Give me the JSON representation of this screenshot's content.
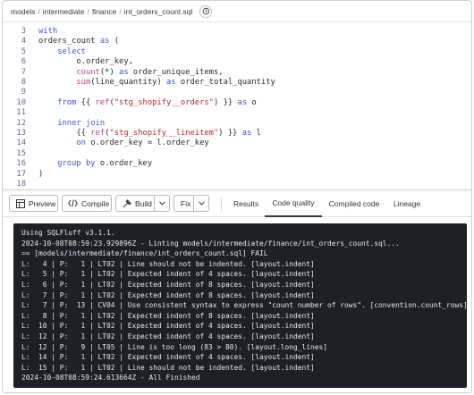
{
  "breadcrumb": [
    "models",
    "intermediate",
    "finance",
    "int_orders_count.sql"
  ],
  "editor": {
    "lines": [
      {
        "n": "3",
        "html": "<span class='kw'>with</span>"
      },
      {
        "n": "4",
        "html": "orders_count <span class='kw'>as</span> ("
      },
      {
        "n": "5",
        "html": "    <span class='kw'>select</span>"
      },
      {
        "n": "6",
        "html": "        o.order_key,"
      },
      {
        "n": "7",
        "html": "        <span class='fn'>count</span>(*) <span class='kw'>as</span> order_unique_items,"
      },
      {
        "n": "8",
        "html": "        <span class='fn'>sum</span>(line_quantity) <span class='kw'>as</span> order_total_quantity"
      },
      {
        "n": "9",
        "html": ""
      },
      {
        "n": "10",
        "html": "    <span class='kw'>from</span> {{ <span class='fn'>ref</span>(<span class='str'>\"stg_shopify__orders\"</span>) }} <span class='kw'>as</span> o"
      },
      {
        "n": "11",
        "html": ""
      },
      {
        "n": "12",
        "html": "    <span class='jn'>inner join</span>"
      },
      {
        "n": "13",
        "html": "        {{ <span class='fn'>ref</span>(<span class='str'>\"stg_shopify__lineitem\"</span>) }} <span class='kw'>as</span> l"
      },
      {
        "n": "14",
        "html": "        <span class='kw'>on</span> o.order_key = l.order_key"
      },
      {
        "n": "15",
        "html": ""
      },
      {
        "n": "16",
        "html": "    <span class='kw'>group by</span> o.order_key"
      },
      {
        "n": "17",
        "html": ")"
      },
      {
        "n": "18",
        "html": ""
      }
    ]
  },
  "toolbar": {
    "preview": "Preview",
    "compile": "Compile",
    "build": "Build",
    "fix": "Fix",
    "tabs": [
      "Results",
      "Code quality",
      "Compiled code",
      "Lineage"
    ],
    "active_tab": "Code quality"
  },
  "console": {
    "lines": [
      "Using SQLFluff v3.1.1.",
      "2024-10-08T08:59:23.929896Z - Linting models/intermediate/finance/int_orders_count.sql...",
      "== [models/intermediate/finance/int_orders_count.sql] FAIL",
      "L:   4 | P:   1 | LT02 | Line should not be indented. [layout.indent]",
      "L:   5 | P:   1 | LT02 | Expected indent of 4 spaces. [layout.indent]",
      "L:   6 | P:   1 | LT02 | Expected indent of 8 spaces. [layout.indent]",
      "L:   7 | P:   1 | LT02 | Expected indent of 8 spaces. [layout.indent]",
      "L:   7 | P:  13 | CV04 | Use consistent syntax to express \"count number of rows\". [convention.count_rows]",
      "L:   8 | P:   1 | LT02 | Expected indent of 8 spaces. [layout.indent]",
      "L:  10 | P:   1 | LT02 | Expected indent of 4 spaces. [layout.indent]",
      "L:  12 | P:   1 | LT02 | Expected indent of 4 spaces. [layout.indent]",
      "L:  12 | P:   9 | LT05 | Line is too long (83 > 80). [layout.long_lines]",
      "L:  14 | P:   1 | LT02 | Expected indent of 4 spaces. [layout.indent]",
      "L:  15 | P:   1 | LT02 | Line should not be indented. [layout.indent]",
      "2024-10-08T08:59:24.613664Z - All Finished"
    ]
  },
  "colors": {
    "keyword": "#3f53c9",
    "function": "#b4478a",
    "string": "#b32d2d",
    "console_bg": "#1d2027"
  }
}
